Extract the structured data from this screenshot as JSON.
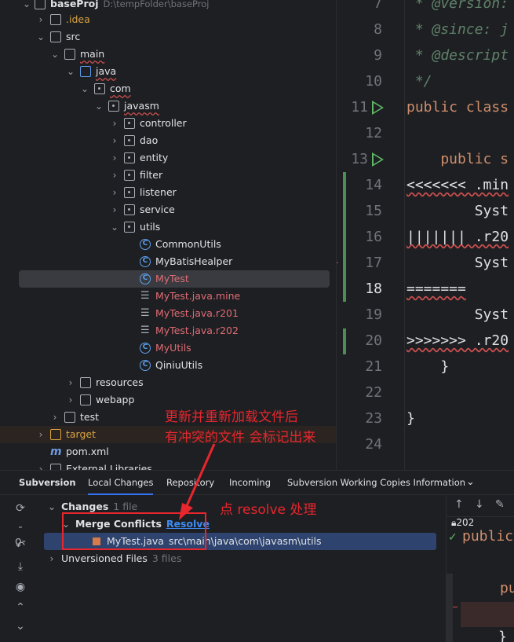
{
  "tree": {
    "project_name": "baseProj",
    "project_path": "D:\\tempFolder\\baseProj",
    "items": [
      {
        "label": "baseProj",
        "depth": 0,
        "type": "module"
      },
      {
        "label": ".idea",
        "depth": 1,
        "type": "folder"
      },
      {
        "label": "src",
        "depth": 1,
        "type": "folder"
      },
      {
        "label": "main",
        "depth": 2,
        "type": "folder"
      },
      {
        "label": "java",
        "depth": 3,
        "type": "source-folder"
      },
      {
        "label": "com",
        "depth": 4,
        "type": "package"
      },
      {
        "label": "javasm",
        "depth": 5,
        "type": "package"
      },
      {
        "label": "controller",
        "depth": 6,
        "type": "package"
      },
      {
        "label": "dao",
        "depth": 6,
        "type": "package"
      },
      {
        "label": "entity",
        "depth": 6,
        "type": "package"
      },
      {
        "label": "filter",
        "depth": 6,
        "type": "package"
      },
      {
        "label": "listener",
        "depth": 6,
        "type": "package"
      },
      {
        "label": "service",
        "depth": 6,
        "type": "package"
      },
      {
        "label": "utils",
        "depth": 6,
        "type": "package"
      },
      {
        "label": "CommonUtils",
        "depth": 7,
        "type": "class"
      },
      {
        "label": "MyBatisHealper",
        "depth": 7,
        "type": "class"
      },
      {
        "label": "MyTest",
        "depth": 7,
        "type": "class-conflict"
      },
      {
        "label": "MyTest.java.mine",
        "depth": 7,
        "type": "file-conflict"
      },
      {
        "label": "MyTest.java.r201",
        "depth": 7,
        "type": "file-conflict"
      },
      {
        "label": "MyTest.java.r202",
        "depth": 7,
        "type": "file-conflict"
      },
      {
        "label": "MyUtils",
        "depth": 7,
        "type": "class-conflict"
      },
      {
        "label": "QiniuUtils",
        "depth": 7,
        "type": "class"
      },
      {
        "label": "resources",
        "depth": 3,
        "type": "folder"
      },
      {
        "label": "webapp",
        "depth": 3,
        "type": "folder"
      },
      {
        "label": "test",
        "depth": 2,
        "type": "folder"
      },
      {
        "label": "target",
        "depth": 1,
        "type": "folder-excluded"
      },
      {
        "label": "pom.xml",
        "depth": 1,
        "type": "maven"
      },
      {
        "label": "External Libraries",
        "depth": 0,
        "type": "libraries"
      }
    ]
  },
  "editor": {
    "lines": [
      {
        "n": "7",
        "text": " * @version: ",
        "kind": "doc"
      },
      {
        "n": "8",
        "text": " * @since: j",
        "kind": "doc"
      },
      {
        "n": "9",
        "text": " * @descript",
        "kind": "doc"
      },
      {
        "n": "10",
        "text": " */",
        "kind": "doc"
      },
      {
        "n": "11",
        "text": "public class",
        "kind": "code"
      },
      {
        "n": "12",
        "text": "",
        "kind": "code"
      },
      {
        "n": "13",
        "text": "    public s",
        "kind": "code"
      },
      {
        "n": "14",
        "text": "<<<<<<< .min",
        "kind": "conflict"
      },
      {
        "n": "15",
        "text": "        Syst",
        "kind": "plain"
      },
      {
        "n": "16",
        "text": "||||||| .r20",
        "kind": "conflict"
      },
      {
        "n": "17",
        "text": "        Syst",
        "kind": "plain"
      },
      {
        "n": "18",
        "text": "=======",
        "kind": "conflict"
      },
      {
        "n": "19",
        "text": "        Syst",
        "kind": "plain"
      },
      {
        "n": "20",
        "text": ">>>>>>> .r20",
        "kind": "conflict"
      },
      {
        "n": "21",
        "text": "    }",
        "kind": "plain"
      },
      {
        "n": "22",
        "text": "",
        "kind": "plain"
      },
      {
        "n": "23",
        "text": "}",
        "kind": "plain"
      },
      {
        "n": "24",
        "text": "",
        "kind": "plain"
      }
    ]
  },
  "toolwindow": {
    "tabs": [
      "Subversion",
      "Local Changes",
      "Repository",
      "Incoming",
      "Subversion Working Copies Information"
    ],
    "changes_label": "Changes",
    "changes_count": "1 file",
    "merge_conflicts_label": "Merge Conflicts",
    "resolve_label": "Resolve",
    "conflict_file": "MyTest.java",
    "conflict_path": "src\\main\\java\\com\\javasm\\utils",
    "unversioned_label": "Unversioned Files",
    "unversioned_count": "3 files",
    "right_revision": "202",
    "right_code_1": "public",
    "right_code_2": "pu",
    "right_code_3": "}"
  },
  "annotations": {
    "note1_line1": "更新并重新加载文件后",
    "note1_line2": "有冲突的文件 会标记出来",
    "note2": "点 resolve 处理"
  },
  "colors": {
    "accent": "#3574f0",
    "annotation": "#e8262d",
    "conflict_file": "#e06c75"
  }
}
